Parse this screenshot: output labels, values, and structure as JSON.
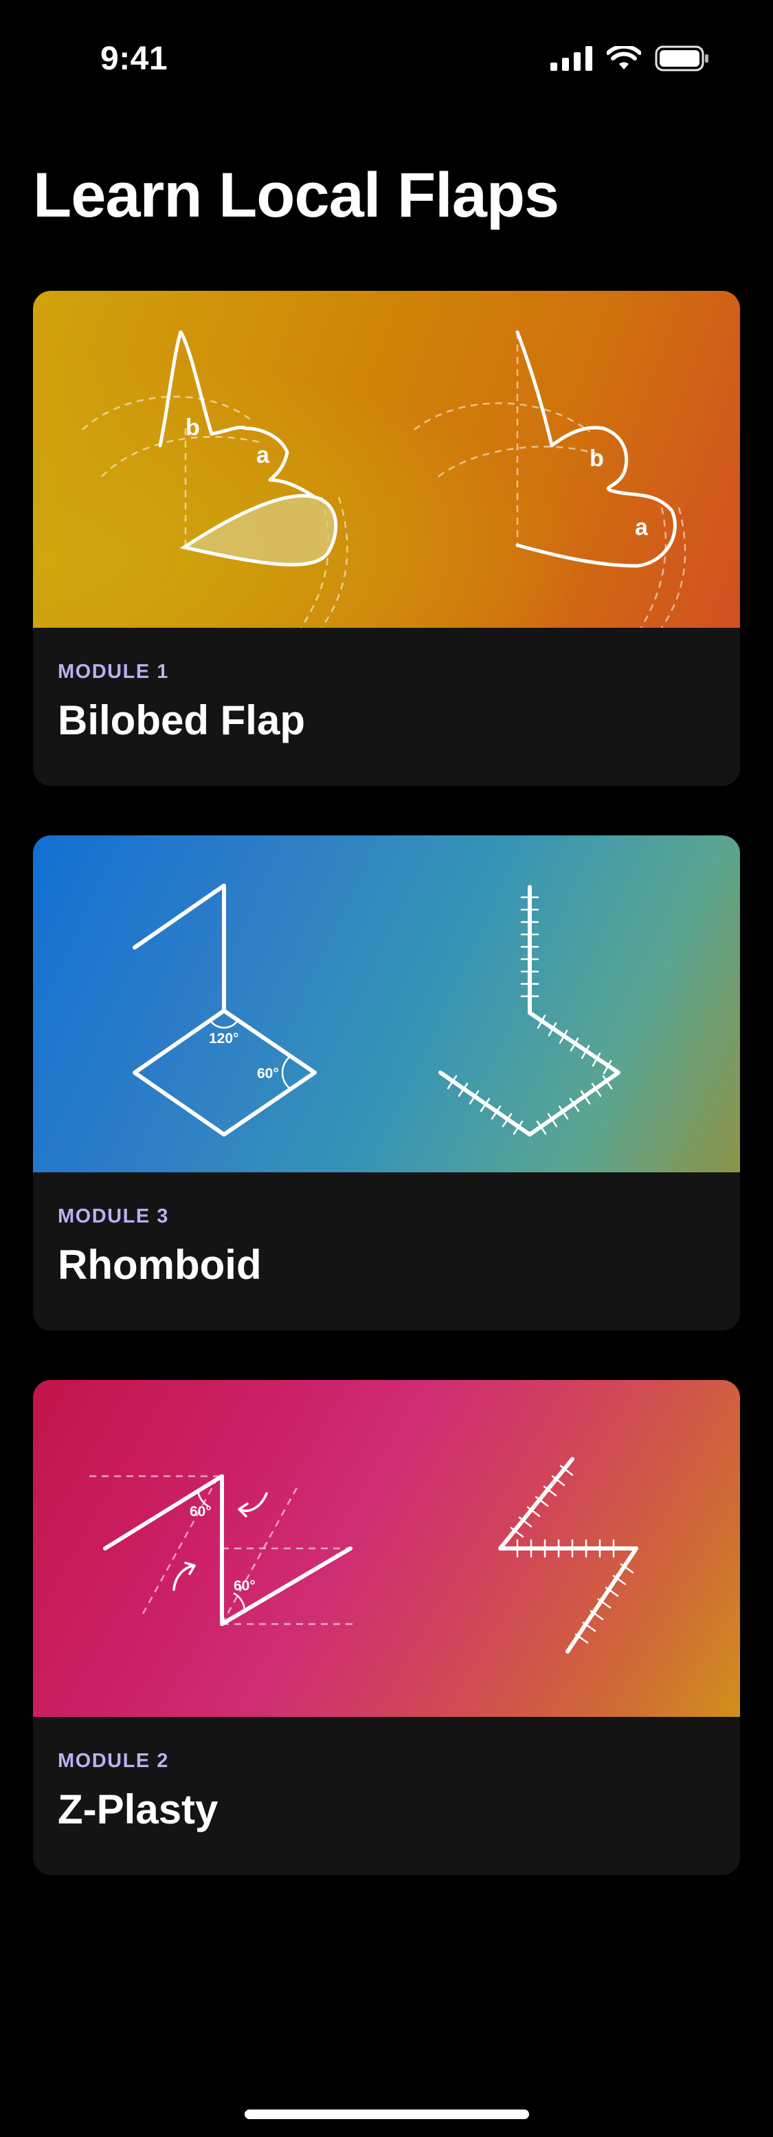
{
  "status_bar": {
    "time": "9:41",
    "icons": [
      "cellular-signal-icon",
      "wifi-icon",
      "battery-icon"
    ]
  },
  "header": {
    "title": "Learn Local Flaps"
  },
  "modules": [
    {
      "label": "MODULE 1",
      "title": "Bilobed Flap",
      "art_labels": {
        "left_b": "b",
        "left_a": "a",
        "right_b": "b",
        "right_a": "a"
      },
      "gradient": [
        "#d1a30d",
        "#cf8408",
        "#d24f22"
      ]
    },
    {
      "label": "MODULE 3",
      "title": "Rhomboid",
      "art_labels": {
        "angle_top": "120°",
        "angle_right": "60°"
      },
      "gradient": [
        "#1270d2",
        "#3694b6",
        "#8d9448"
      ]
    },
    {
      "label": "MODULE 2",
      "title": "Z-Plasty",
      "art_labels": {
        "angle_top": "60°",
        "angle_bottom": "60°"
      },
      "gradient": [
        "#c3144a",
        "#cf2d73",
        "#d0901c"
      ]
    }
  ],
  "colors": {
    "background": "#000000",
    "card": "#141414",
    "module_label": "#b7b3ee"
  }
}
